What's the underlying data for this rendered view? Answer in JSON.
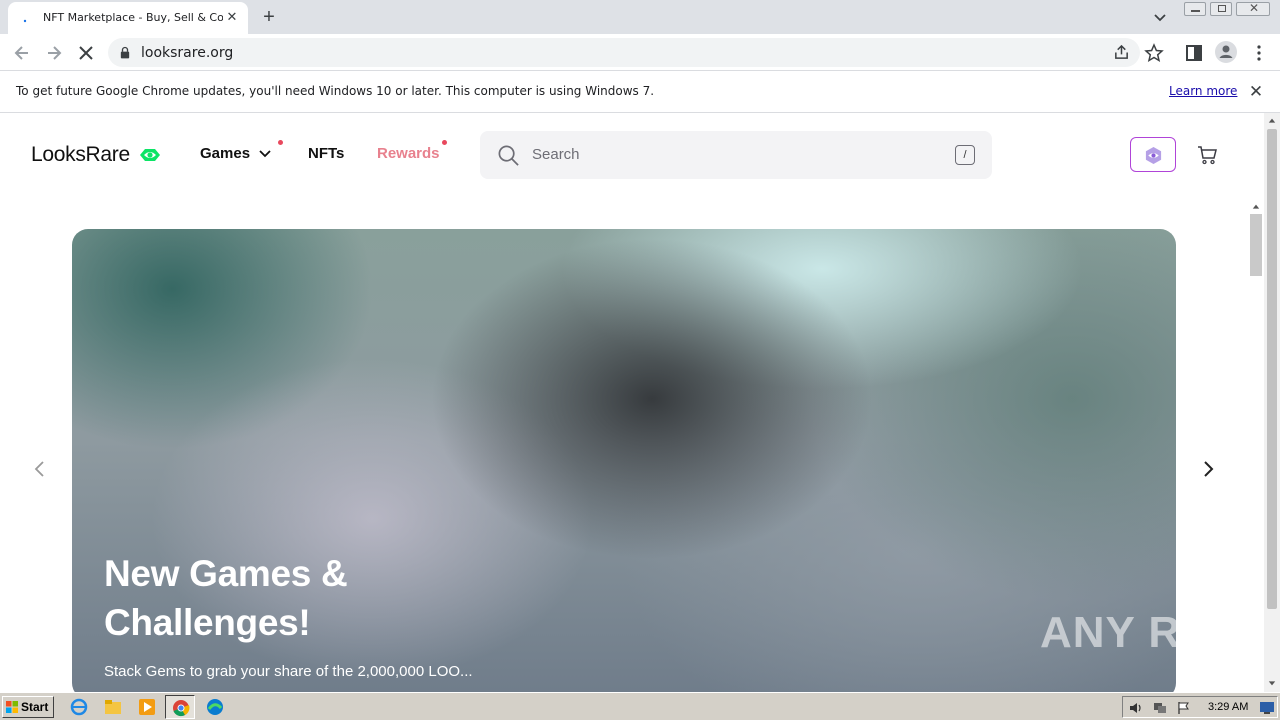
{
  "browser": {
    "tab_title": "NFT Marketplace - Buy, Sell & Collect",
    "url": "looksrare.org",
    "infobar_message": "To get future Google Chrome updates, you'll need Windows 10 or later. This computer is using Windows 7.",
    "infobar_link": "Learn more"
  },
  "site": {
    "logo_text": "LooksRare",
    "nav": {
      "games": "Games",
      "nfts": "NFTs",
      "rewards": "Rewards"
    },
    "search_placeholder": "Search",
    "search_shortcut": "/",
    "colors": {
      "brand_green": "#0ce466",
      "rewards": "#e8818e",
      "notification_dot": "#e8485d",
      "accent_purple": "#b044d8"
    }
  },
  "hero": {
    "title_line1": "New Games &",
    "title_line2": "Challenges!",
    "subtitle": "Stack Gems to grab your share of the 2,000,000 LOO..."
  },
  "watermark": "ANY RUN",
  "taskbar": {
    "start_label": "Start",
    "clock": "3:29 AM"
  }
}
